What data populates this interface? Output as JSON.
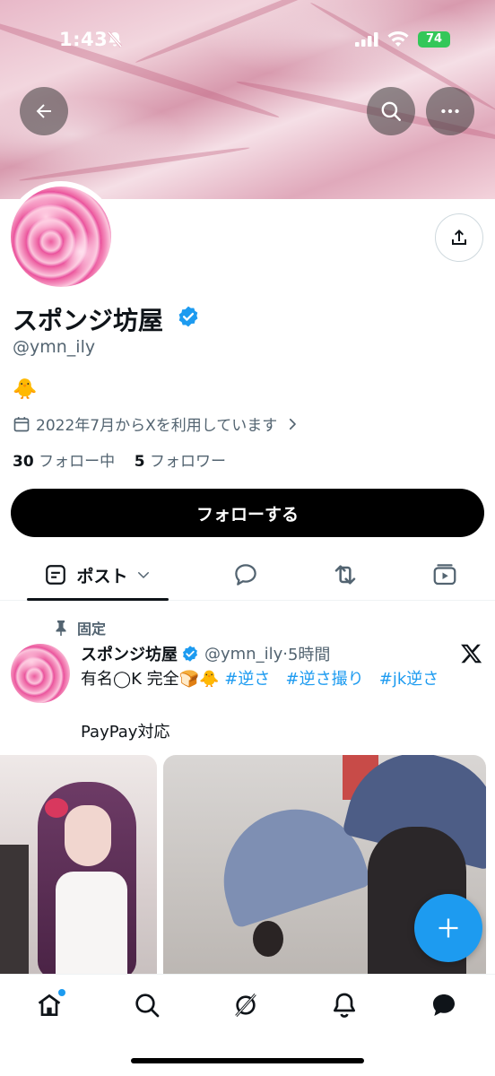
{
  "status_bar": {
    "time": "1:43",
    "battery": "74"
  },
  "header": {
    "back_icon": "arrow-left-icon",
    "search_icon": "search-icon",
    "more_icon": "more-icon"
  },
  "profile": {
    "display_name": "スポンジ坊屋",
    "handle": "@ymn_ily",
    "bio": "🐥",
    "joined": "2022年7月からXを利用しています",
    "following_count": "30",
    "following_label": "フォロー中",
    "followers_count": "5",
    "followers_label": "フォロワー",
    "follow_button": "フォローする"
  },
  "tabs": {
    "posts_label": "ポスト"
  },
  "pinned_post": {
    "pinned_label": "固定",
    "author_name": "スポンジ坊屋",
    "author_handle": "@ymn_ily",
    "separator": "·",
    "time": "5時間",
    "text_plain": "有名◯K 完全🍞🐥 ",
    "tags": [
      "#逆さ",
      "#逆さ撮り",
      "#jk逆さ"
    ],
    "text_line2": "PayPay対応"
  },
  "colors": {
    "accent": "#1d9bf0",
    "text": "#0f1419",
    "muted": "#536471"
  }
}
